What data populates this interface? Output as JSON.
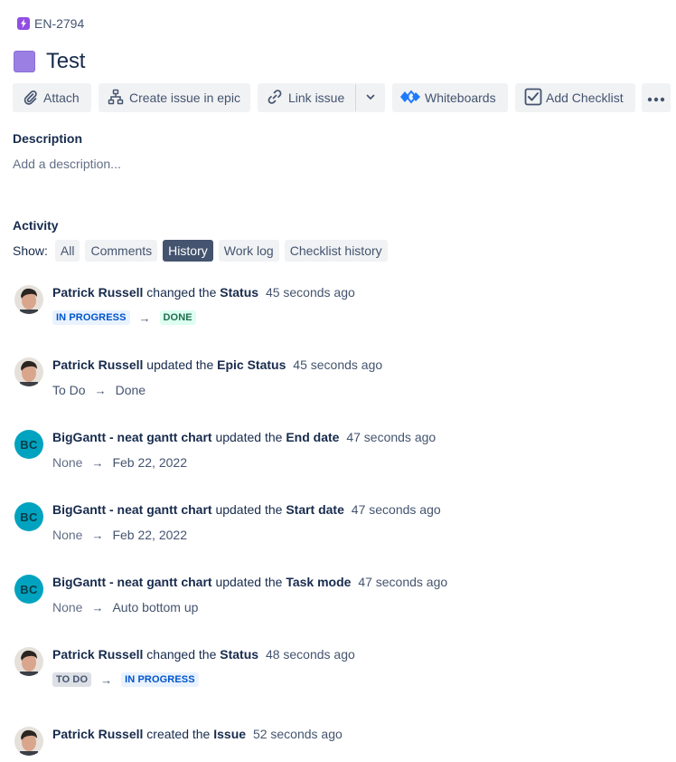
{
  "breadcrumb": {
    "issue_key": "EN-2794"
  },
  "issue": {
    "title": "Test"
  },
  "toolbar": {
    "attach": "Attach",
    "create_issue_in_epic": "Create issue in epic",
    "link_issue": "Link issue",
    "whiteboards": "Whiteboards",
    "add_checklist": "Add Checklist"
  },
  "description": {
    "heading": "Description",
    "placeholder": "Add a description..."
  },
  "activity": {
    "heading": "Activity",
    "show_label": "Show:",
    "filters": [
      "All",
      "Comments",
      "History",
      "Work log",
      "Checklist history"
    ],
    "active_filter": "History",
    "entries": [
      {
        "actor": "Patrick Russell",
        "verb": "changed the",
        "field": "Status",
        "time": "45 seconds ago",
        "from": "IN PROGRESS",
        "to": "DONE",
        "avatar": "photo"
      },
      {
        "actor": "Patrick Russell",
        "verb": "updated the",
        "field": "Epic Status",
        "time": "45 seconds ago",
        "from": "To Do",
        "to": "Done",
        "avatar": "photo"
      },
      {
        "actor": "BigGantt - neat gantt chart",
        "verb": "updated the",
        "field": "End date",
        "time": "47 seconds ago",
        "from": "None",
        "to": "Feb 22, 2022",
        "avatar": "BC"
      },
      {
        "actor": "BigGantt - neat gantt chart",
        "verb": "updated the",
        "field": "Start date",
        "time": "47 seconds ago",
        "from": "None",
        "to": "Feb 22, 2022",
        "avatar": "BC"
      },
      {
        "actor": "BigGantt - neat gantt chart",
        "verb": "updated the",
        "field": "Task mode",
        "time": "47 seconds ago",
        "from": "None",
        "to": "Auto bottom up",
        "avatar": "BC"
      },
      {
        "actor": "Patrick Russell",
        "verb": "changed the",
        "field": "Status",
        "time": "48 seconds ago",
        "from": "TO DO",
        "to": "IN PROGRESS",
        "avatar": "photo"
      },
      {
        "actor": "Patrick Russell",
        "verb": "created the",
        "field": "Issue",
        "time": "52 seconds ago",
        "avatar": "photo"
      }
    ]
  },
  "colors": {
    "epic_purple": "#904ee2",
    "active_filter_bg": "#44546f",
    "avatar_bc_bg": "#00a3bf",
    "lozenge_in_progress": "#e9f2ff",
    "lozenge_done": "#dcfff1",
    "lozenge_todo": "#dcdfe4"
  },
  "icons": [
    "lightning-icon",
    "paperclip-icon",
    "hierarchy-icon",
    "link-icon",
    "chevron-down-icon",
    "whiteboards-icon",
    "checkbox-icon",
    "more-icon",
    "arrow-right-icon"
  ]
}
